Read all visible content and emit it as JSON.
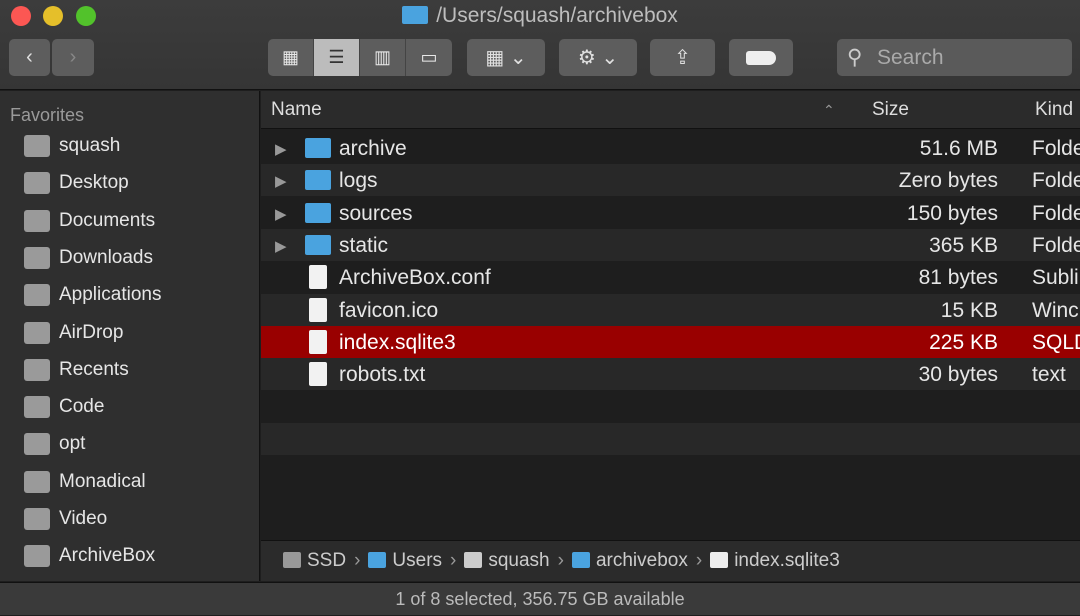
{
  "window": {
    "title": "/Users/squash/archivebox"
  },
  "toolbar": {
    "back": "‹",
    "forward": "›",
    "search_placeholder": "Search"
  },
  "sidebar": {
    "header": "Favorites",
    "items": [
      {
        "label": "squash"
      },
      {
        "label": "Desktop"
      },
      {
        "label": "Documents"
      },
      {
        "label": "Downloads"
      },
      {
        "label": "Applications"
      },
      {
        "label": "AirDrop"
      },
      {
        "label": "Recents"
      },
      {
        "label": "Code"
      },
      {
        "label": "opt"
      },
      {
        "label": "Monadical"
      },
      {
        "label": "Video"
      },
      {
        "label": "ArchiveBox"
      }
    ]
  },
  "columns": {
    "name": "Name",
    "size": "Size",
    "kind": "Kind"
  },
  "files": [
    {
      "name": "archive",
      "size": "51.6 MB",
      "kind": "Folde",
      "type": "folder"
    },
    {
      "name": "logs",
      "size": "Zero bytes",
      "kind": "Folde",
      "type": "folder"
    },
    {
      "name": "sources",
      "size": "150 bytes",
      "kind": "Folde",
      "type": "folder"
    },
    {
      "name": "static",
      "size": "365 KB",
      "kind": "Folde",
      "type": "folder"
    },
    {
      "name": "ArchiveBox.conf",
      "size": "81 bytes",
      "kind": "Subli",
      "type": "file"
    },
    {
      "name": "favicon.ico",
      "size": "15 KB",
      "kind": "Winc",
      "type": "file"
    },
    {
      "name": "index.sqlite3",
      "size": "225 KB",
      "kind": "SQLD",
      "type": "file",
      "selected": true
    },
    {
      "name": "robots.txt",
      "size": "30 bytes",
      "kind": "text",
      "type": "file"
    }
  ],
  "pathbar": [
    "SSD",
    "Users",
    "squash",
    "archivebox",
    "index.sqlite3"
  ],
  "status": "1 of 8 selected, 356.75 GB available",
  "colors": {
    "selection": "#990000",
    "folder": "#4aa3df"
  }
}
